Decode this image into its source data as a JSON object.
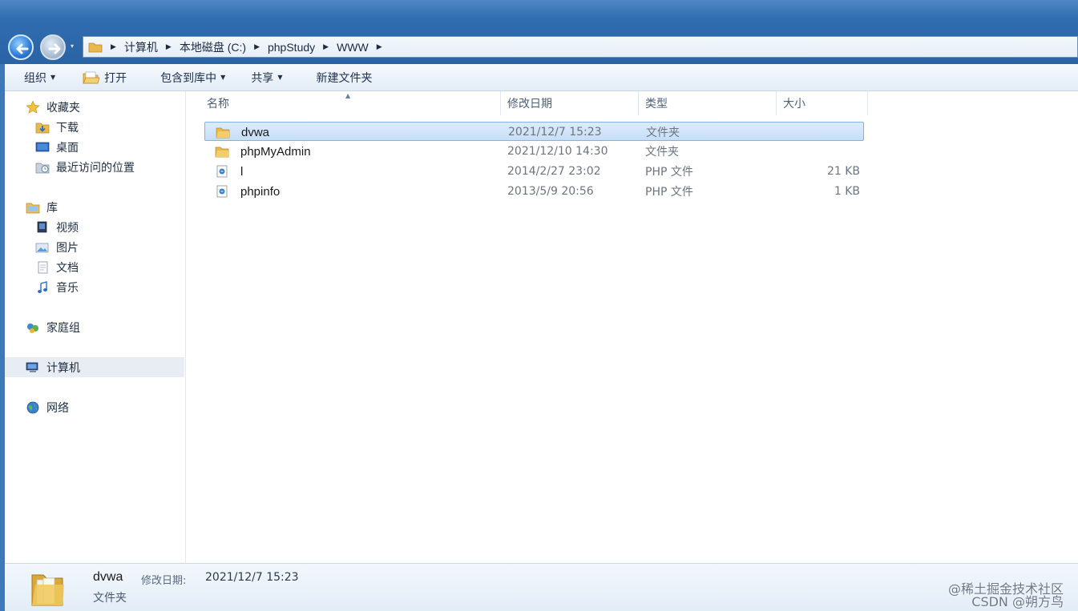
{
  "address": {
    "crumbs": [
      "计算机",
      "本地磁盘 (C:)",
      "phpStudy",
      "WWW"
    ]
  },
  "toolbar": {
    "organize": "组织",
    "open": "打开",
    "include_in_library": "包含到库中",
    "share": "共享",
    "new_folder": "新建文件夹"
  },
  "nav": {
    "favorites": "收藏夹",
    "downloads": "下载",
    "desktop": "桌面",
    "recent": "最近访问的位置",
    "libraries": "库",
    "videos": "视频",
    "pictures": "图片",
    "documents": "文档",
    "music": "音乐",
    "homegroup": "家庭组",
    "computer": "计算机",
    "network": "网络"
  },
  "columns": {
    "name": "名称",
    "date": "修改日期",
    "type": "类型",
    "size": "大小"
  },
  "files": [
    {
      "name": "dvwa",
      "date": "2021/12/7 15:23",
      "type": "文件夹",
      "size": ""
    },
    {
      "name": "phpMyAdmin",
      "date": "2021/12/10 14:30",
      "type": "文件夹",
      "size": ""
    },
    {
      "name": "l",
      "date": "2014/2/27 23:02",
      "type": "PHP 文件",
      "size": "21 KB"
    },
    {
      "name": "phpinfo",
      "date": "2013/5/9 20:56",
      "type": "PHP 文件",
      "size": "1 KB"
    }
  ],
  "details": {
    "name": "dvwa",
    "date_label": "修改日期:",
    "date": "2021/12/7 15:23",
    "type": "文件夹"
  },
  "watermark": {
    "line1": "@稀土掘金技术社区",
    "line2": "CSDN @朔方鸟"
  },
  "colors": {
    "title_bar": "#2f6db0",
    "selection": "#c7def6",
    "folder": "#e8b84a"
  }
}
